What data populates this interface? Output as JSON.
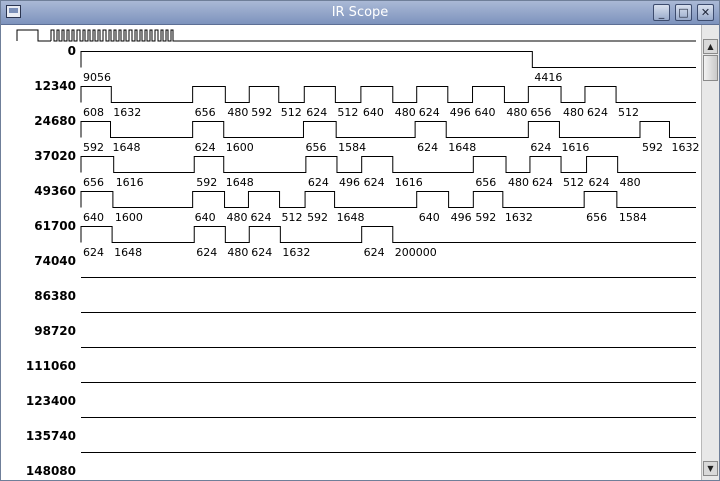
{
  "window": {
    "title": "IR Scope",
    "minimize_glyph": "_",
    "maximize_glyph": "□",
    "close_glyph": "✕"
  },
  "icons": {
    "app": "window-icon",
    "scroll_up": "arrow-up-icon",
    "scroll_down": "arrow-down-icon"
  },
  "scrollbar": {
    "up_glyph": "▲",
    "down_glyph": "▼",
    "position_fraction": 0.02
  },
  "scope": {
    "overview_count": 24,
    "rows": [
      {
        "offset": "0",
        "segments": [
          {
            "d": 9056,
            "level": 1,
            "label": "9056"
          },
          {
            "d": 4416,
            "level": 0,
            "label": "4416"
          }
        ]
      },
      {
        "offset": "12340",
        "segments": [
          {
            "d": 608,
            "level": 1,
            "label": "608"
          },
          {
            "d": 1632,
            "level": 0,
            "label": "1632"
          },
          {
            "d": 656,
            "level": 1,
            "label": "656"
          },
          {
            "d": 480,
            "level": 0,
            "label": "480"
          },
          {
            "d": 592,
            "level": 1,
            "label": "592"
          },
          {
            "d": 512,
            "level": 0,
            "label": "512"
          },
          {
            "d": 624,
            "level": 1,
            "label": "624"
          },
          {
            "d": 512,
            "level": 0,
            "label": "512"
          },
          {
            "d": 640,
            "level": 1,
            "label": "640"
          },
          {
            "d": 480,
            "level": 0,
            "label": "480"
          },
          {
            "d": 624,
            "level": 1,
            "label": "624"
          },
          {
            "d": 496,
            "level": 0,
            "label": "496"
          },
          {
            "d": 640,
            "level": 1,
            "label": "640"
          },
          {
            "d": 480,
            "level": 0,
            "label": "480"
          },
          {
            "d": 656,
            "level": 1,
            "label": "656"
          },
          {
            "d": 480,
            "level": 0,
            "label": "480"
          },
          {
            "d": 624,
            "level": 1,
            "label": "624"
          },
          {
            "d": 512,
            "level": 0,
            "label": "512"
          }
        ]
      },
      {
        "offset": "24680",
        "segments": [
          {
            "d": 592,
            "level": 1,
            "label": "592"
          },
          {
            "d": 1648,
            "level": 0,
            "label": "1648"
          },
          {
            "d": 624,
            "level": 1,
            "label": "624"
          },
          {
            "d": 1600,
            "level": 0,
            "label": "1600"
          },
          {
            "d": 656,
            "level": 1,
            "label": "656"
          },
          {
            "d": 1584,
            "level": 0,
            "label": "1584"
          },
          {
            "d": 624,
            "level": 1,
            "label": "624"
          },
          {
            "d": 1648,
            "level": 0,
            "label": "1648"
          },
          {
            "d": 624,
            "level": 1,
            "label": "624"
          },
          {
            "d": 1616,
            "level": 0,
            "label": "1616"
          },
          {
            "d": 592,
            "level": 1,
            "label": "592"
          },
          {
            "d": 1632,
            "level": 0,
            "label": "1632"
          }
        ]
      },
      {
        "offset": "37020",
        "segments": [
          {
            "d": 656,
            "level": 1,
            "label": "656"
          },
          {
            "d": 1616,
            "level": 0,
            "label": "1616"
          },
          {
            "d": 592,
            "level": 1,
            "label": "592"
          },
          {
            "d": 1648,
            "level": 0,
            "label": "1648"
          },
          {
            "d": 624,
            "level": 1,
            "label": "624"
          },
          {
            "d": 496,
            "level": 0,
            "label": "496"
          },
          {
            "d": 624,
            "level": 1,
            "label": "624"
          },
          {
            "d": 1616,
            "level": 0,
            "label": "1616"
          },
          {
            "d": 656,
            "level": 1,
            "label": "656"
          },
          {
            "d": 480,
            "level": 0,
            "label": "480"
          },
          {
            "d": 624,
            "level": 1,
            "label": "624"
          },
          {
            "d": 512,
            "level": 0,
            "label": "512"
          },
          {
            "d": 624,
            "level": 1,
            "label": "624"
          },
          {
            "d": 480,
            "level": 0,
            "label": "480"
          }
        ]
      },
      {
        "offset": "49360",
        "segments": [
          {
            "d": 640,
            "level": 1,
            "label": "640"
          },
          {
            "d": 1600,
            "level": 0,
            "label": "1600"
          },
          {
            "d": 640,
            "level": 1,
            "label": "640"
          },
          {
            "d": 480,
            "level": 0,
            "label": "480"
          },
          {
            "d": 624,
            "level": 1,
            "label": "624"
          },
          {
            "d": 512,
            "level": 0,
            "label": "512"
          },
          {
            "d": 592,
            "level": 1,
            "label": "592"
          },
          {
            "d": 1648,
            "level": 0,
            "label": "1648"
          },
          {
            "d": 640,
            "level": 1,
            "label": "640"
          },
          {
            "d": 496,
            "level": 0,
            "label": "496"
          },
          {
            "d": 592,
            "level": 1,
            "label": "592"
          },
          {
            "d": 1632,
            "level": 0,
            "label": "1632"
          },
          {
            "d": 656,
            "level": 1,
            "label": "656"
          },
          {
            "d": 1584,
            "level": 0,
            "label": "1584"
          }
        ]
      },
      {
        "offset": "61700",
        "segments": [
          {
            "d": 624,
            "level": 1,
            "label": "624"
          },
          {
            "d": 1648,
            "level": 0,
            "label": "1648"
          },
          {
            "d": 624,
            "level": 1,
            "label": "624"
          },
          {
            "d": 480,
            "level": 0,
            "label": "480"
          },
          {
            "d": 624,
            "level": 1,
            "label": "624"
          },
          {
            "d": 1632,
            "level": 0,
            "label": "1632"
          },
          {
            "d": 624,
            "level": 1,
            "label": "624"
          },
          {
            "d": 200000,
            "level": 0,
            "label": "200000"
          }
        ]
      },
      {
        "offset": "74040",
        "segments": []
      },
      {
        "offset": "86380",
        "segments": []
      },
      {
        "offset": "98720",
        "segments": []
      },
      {
        "offset": "111060",
        "segments": []
      },
      {
        "offset": "123400",
        "segments": []
      },
      {
        "offset": "135740",
        "segments": []
      },
      {
        "offset": "148080",
        "segments": []
      }
    ]
  }
}
